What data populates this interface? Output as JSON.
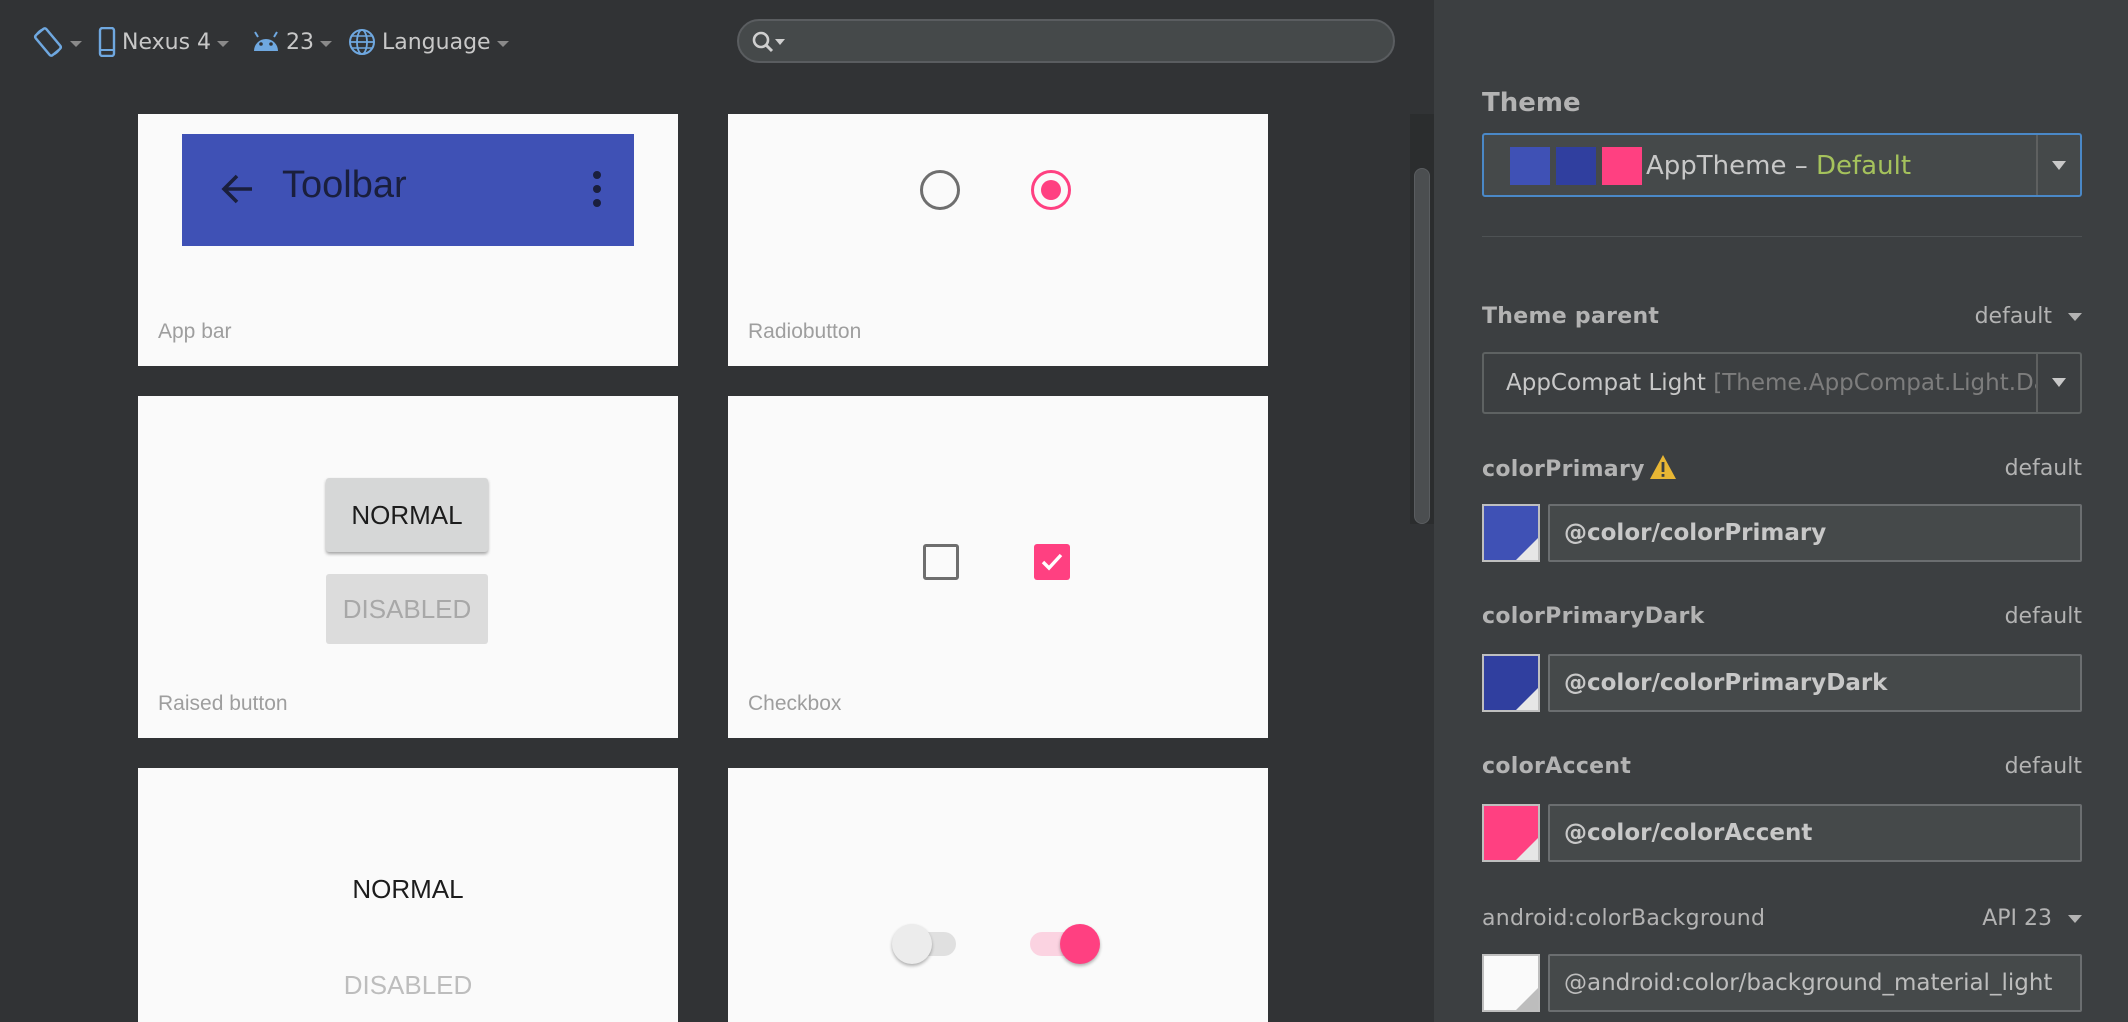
{
  "toolbar": {
    "rotate_icon": "rotate-screen-icon",
    "device_label": "Nexus 4",
    "api_label": "23",
    "language_label": "Language",
    "search_placeholder": ""
  },
  "preview": {
    "cards": {
      "app_bar": {
        "caption": "App bar",
        "toolbar_title": "Toolbar"
      },
      "radiobutton": {
        "caption": "Radiobutton"
      },
      "raised_button": {
        "caption": "Raised button",
        "normal": "NORMAL",
        "disabled": "DISABLED"
      },
      "checkbox": {
        "caption": "Checkbox"
      },
      "flat_button": {
        "normal": "NORMAL",
        "disabled": "DISABLED"
      },
      "switch": {}
    }
  },
  "panel": {
    "theme_title": "Theme",
    "theme_select": {
      "name": "AppTheme",
      "separator": " – ",
      "variant": "Default"
    },
    "theme_parent": {
      "label": "Theme parent",
      "mode": "default",
      "value": "AppCompat Light",
      "detail": " [Theme.AppCompat.Light.DarkActionBar]"
    },
    "attributes": [
      {
        "name": "colorPrimary",
        "mode": "default",
        "value": "@color/colorPrimary",
        "color": "#3f51b5",
        "warning": true
      },
      {
        "name": "colorPrimaryDark",
        "mode": "default",
        "value": "@color/colorPrimaryDark",
        "color": "#303f9f"
      },
      {
        "name": "colorAccent",
        "mode": "default",
        "value": "@color/colorAccent",
        "color": "#ff4081"
      },
      {
        "name": "android:colorBackground",
        "mode": "API 23",
        "value": "@android:color/background_material_light",
        "color": "#fafafa"
      }
    ]
  },
  "colors": {
    "primary": "#3f51b5",
    "primary_dark": "#303f9f",
    "accent": "#ff4081",
    "focus_border": "#4a88c7",
    "default_text": "#a5c25c"
  }
}
